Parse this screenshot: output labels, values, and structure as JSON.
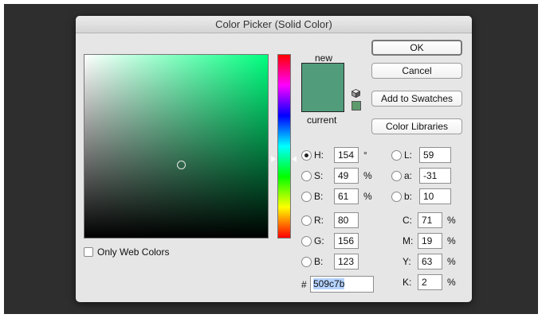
{
  "window": {
    "title": "Color Picker (Solid Color)"
  },
  "colors": {
    "new": "#509c7b",
    "current": "#509c7b"
  },
  "preview": {
    "new_label": "new",
    "current_label": "current"
  },
  "icons": [
    "cube-icon",
    "websafe-swatch-icon"
  ],
  "buttons": {
    "ok": "OK",
    "cancel": "Cancel",
    "add_to_swatches": "Add to Swatches",
    "color_libraries": "Color Libraries"
  },
  "only_web_colors": {
    "label": "Only Web Colors",
    "checked": false
  },
  "selected_mode": "H",
  "hsb": [
    {
      "label": "H:",
      "value": "154",
      "unit": "°"
    },
    {
      "label": "S:",
      "value": "49",
      "unit": "%"
    },
    {
      "label": "B:",
      "value": "61",
      "unit": "%"
    }
  ],
  "rgb": [
    {
      "label": "R:",
      "value": "80"
    },
    {
      "label": "G:",
      "value": "156"
    },
    {
      "label": "B:",
      "value": "123"
    }
  ],
  "lab": [
    {
      "label": "L:",
      "value": "59"
    },
    {
      "label": "a:",
      "value": "-31"
    },
    {
      "label": "b:",
      "value": "10"
    }
  ],
  "cmyk": [
    {
      "label": "C:",
      "value": "71",
      "unit": "%"
    },
    {
      "label": "M:",
      "value": "19",
      "unit": "%"
    },
    {
      "label": "Y:",
      "value": "63",
      "unit": "%"
    },
    {
      "label": "K:",
      "value": "2",
      "unit": "%"
    }
  ],
  "hex": {
    "label": "#",
    "value": "509c7b"
  }
}
